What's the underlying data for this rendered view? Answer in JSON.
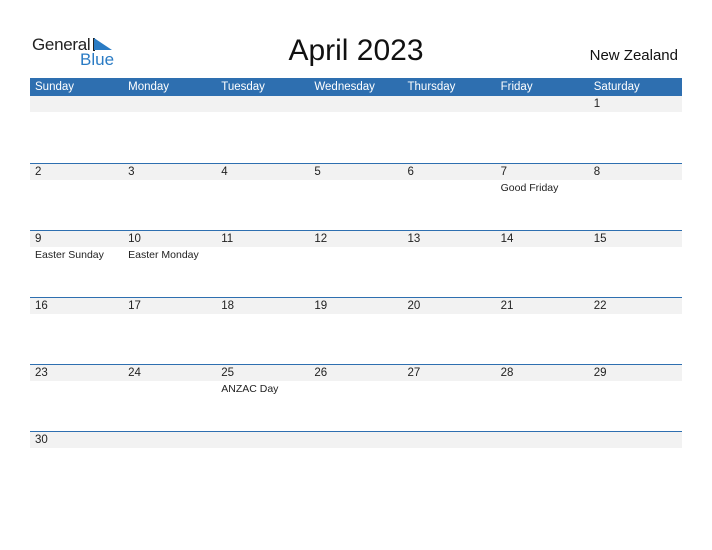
{
  "brand": {
    "word1": "General",
    "word2": "Blue",
    "accent": "#2a7bc4"
  },
  "title": "April 2023",
  "country": "New Zealand",
  "colors": {
    "header_bg": "#2e6fb0",
    "date_strip_bg": "#f2f2f2"
  },
  "weekdays": [
    "Sunday",
    "Monday",
    "Tuesday",
    "Wednesday",
    "Thursday",
    "Friday",
    "Saturday"
  ],
  "weeks": [
    {
      "dates": [
        "",
        "",
        "",
        "",
        "",
        "",
        "1"
      ],
      "events": [
        "",
        "",
        "",
        "",
        "",
        "",
        ""
      ]
    },
    {
      "dates": [
        "2",
        "3",
        "4",
        "5",
        "6",
        "7",
        "8"
      ],
      "events": [
        "",
        "",
        "",
        "",
        "",
        "Good Friday",
        ""
      ]
    },
    {
      "dates": [
        "9",
        "10",
        "11",
        "12",
        "13",
        "14",
        "15"
      ],
      "events": [
        "Easter Sunday",
        "Easter Monday",
        "",
        "",
        "",
        "",
        ""
      ]
    },
    {
      "dates": [
        "16",
        "17",
        "18",
        "19",
        "20",
        "21",
        "22"
      ],
      "events": [
        "",
        "",
        "",
        "",
        "",
        "",
        ""
      ]
    },
    {
      "dates": [
        "23",
        "24",
        "25",
        "26",
        "27",
        "28",
        "29"
      ],
      "events": [
        "",
        "",
        "ANZAC Day",
        "",
        "",
        "",
        ""
      ]
    },
    {
      "dates": [
        "30",
        "",
        "",
        "",
        "",
        "",
        ""
      ],
      "events": [
        "",
        "",
        "",
        "",
        "",
        "",
        ""
      ]
    }
  ]
}
